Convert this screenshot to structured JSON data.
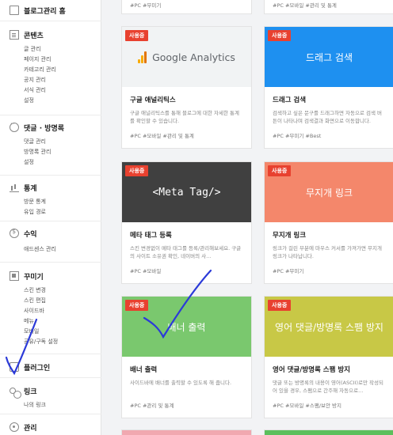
{
  "sidebar": {
    "home": "블로그관리 홈",
    "contents": {
      "title": "콘텐츠",
      "items": [
        "글 관리",
        "페이지 관리",
        "카테고리 관리",
        "공지 관리",
        "서식 관리",
        "설정"
      ]
    },
    "comments": {
      "title": "댓글 · 방명록",
      "items": [
        "댓글 관리",
        "방명록 관리",
        "설정"
      ]
    },
    "stats": {
      "title": "통계",
      "items": [
        "방문 통계",
        "유입 경로"
      ]
    },
    "revenue": {
      "title": "수익",
      "items": [
        "애드센스 관리"
      ]
    },
    "decorate": {
      "title": "꾸미기",
      "items": [
        "스킨 변경",
        "스킨 편집",
        "사이드바",
        "메뉴",
        "모바일",
        "구독 설정"
      ],
      "partial_item": "공유/구독 설정"
    },
    "plugin": {
      "title": "플러그인"
    },
    "link": {
      "title": "링크",
      "items": [
        "나의 링크"
      ]
    },
    "manage": {
      "title": "관리"
    }
  },
  "main": {
    "top_tags_left": "#PC  #무미기",
    "top_tags_right": "#PC  #모바일  #관리 및 통계",
    "cards": [
      {
        "badge": "사용중",
        "thumb_text": "Google Analytics",
        "title": "구글 애널리틱스",
        "desc": "구글 애널리틱스를 통해 블로그에 대한 자세한 통계를 확인할 수 있습니다.",
        "tags": "#PC  #모바일  #관리 및 통계",
        "thumb_color": "#f1f3f4"
      },
      {
        "badge": "사용중",
        "thumb_text": "드래그 검색",
        "title": "드래그 검색",
        "desc": "검색하고 싶은 문구를 드래그하면 자동으로 검색 버튼이 나타나며 검색결과 화면으로 이동합니다.",
        "tags": "#PC  #무미기  #Best",
        "thumb_color": "#1e90f0"
      },
      {
        "badge": "사용중",
        "thumb_text": "<Meta Tag/>",
        "title": "메타 태그 등록",
        "desc": "스킨 변경없이 메타 태그를 등록/관리해보세요. 구글의 사이트 소유권 확인, 네이버의 사...",
        "tags": "#PC  #모바일",
        "thumb_color": "#404040"
      },
      {
        "badge": "사용중",
        "thumb_text": "무지개 링크",
        "title": "무지개 링크",
        "desc": "링크가 걸린 부분에 마우스 커서를 가져가면 무지개 링크가 나타납니다.",
        "tags": "#PC  #무미기",
        "thumb_color": "#f4876b"
      },
      {
        "badge": "사용중",
        "thumb_text": "배너 출력",
        "title": "배너 출력",
        "desc": "사이드바에 배너를 출력할 수 있도록 해 줍니다.",
        "tags": "#PC  #관리 및 통계",
        "thumb_color": "#7ac86e"
      },
      {
        "badge": "사용중",
        "thumb_text": "영어 댓글/방명록 스팸 방지",
        "title": "영어 댓글/방명록 스팸 방지",
        "desc": "댓글 또는 방명록의 내용이 영어(ASCII)로만 작성되어 있을 경우, 스팸으로 간주해 자동으로...",
        "tags": "#PC  #모바일  #스팸/보안 방지",
        "thumb_color": "#c8c846"
      }
    ]
  }
}
